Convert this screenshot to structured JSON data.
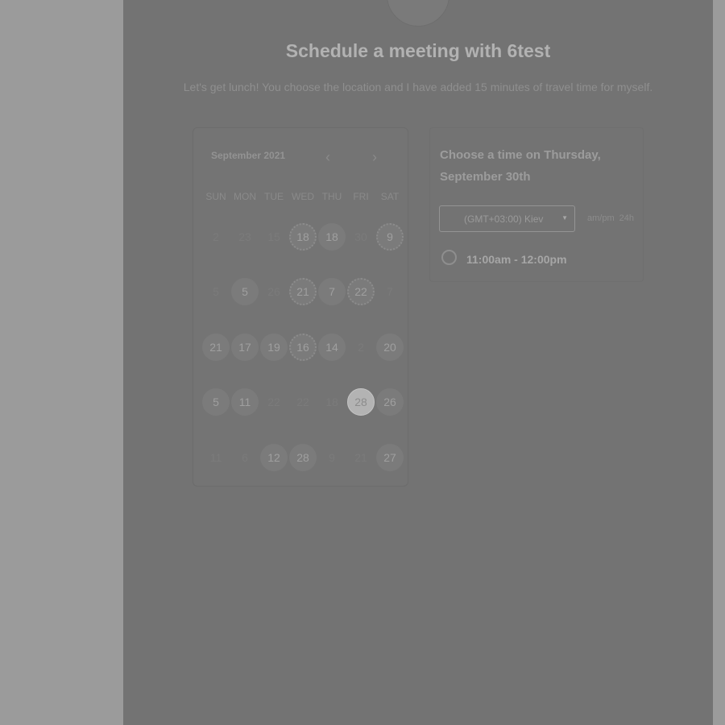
{
  "header": {
    "title": "Schedule a meeting with 6test",
    "description": "Let's get lunch! You choose the location and I have added 15 minutes of travel time for myself."
  },
  "calendar": {
    "month": "September 2021",
    "prev_icon": "‹",
    "next_icon": "›",
    "weekdays": [
      "SUN",
      "MON",
      "TUE",
      "WED",
      "THU",
      "FRI",
      "SAT"
    ],
    "weeks": [
      [
        {
          "d": "2",
          "s": "faint"
        },
        {
          "d": "23",
          "s": "faint"
        },
        {
          "d": "15",
          "s": "faint"
        },
        {
          "d": "18",
          "s": "dotted"
        },
        {
          "d": "18",
          "s": "avail"
        },
        {
          "d": "30",
          "s": "faint"
        },
        {
          "d": "9",
          "s": "dotted"
        }
      ],
      [
        {
          "d": "5",
          "s": "faint"
        },
        {
          "d": "5",
          "s": "avail"
        },
        {
          "d": "26",
          "s": "faint"
        },
        {
          "d": "21",
          "s": "dotted"
        },
        {
          "d": "7",
          "s": "avail"
        },
        {
          "d": "22",
          "s": "dotted"
        },
        {
          "d": "7",
          "s": "faint"
        }
      ],
      [
        {
          "d": "21",
          "s": "avail"
        },
        {
          "d": "17",
          "s": "avail"
        },
        {
          "d": "19",
          "s": "avail"
        },
        {
          "d": "16",
          "s": "dotted"
        },
        {
          "d": "14",
          "s": "avail"
        },
        {
          "d": "2",
          "s": "faint"
        },
        {
          "d": "20",
          "s": "avail"
        }
      ],
      [
        {
          "d": "5",
          "s": "avail"
        },
        {
          "d": "11",
          "s": "avail"
        },
        {
          "d": "22",
          "s": "faint"
        },
        {
          "d": "22",
          "s": "faint"
        },
        {
          "d": "18",
          "s": "faint"
        },
        {
          "d": "28",
          "s": "selected"
        },
        {
          "d": "26",
          "s": "avail"
        }
      ],
      [
        {
          "d": "11",
          "s": "faint"
        },
        {
          "d": "6",
          "s": "faint"
        },
        {
          "d": "12",
          "s": "avail"
        },
        {
          "d": "28",
          "s": "avail"
        },
        {
          "d": "9",
          "s": "faint"
        },
        {
          "d": "21",
          "s": "faint"
        },
        {
          "d": "27",
          "s": "avail"
        }
      ]
    ]
  },
  "time_panel": {
    "heading": "Choose a time on Thursday, September 30th",
    "timezone": "(GMT+03:00) Kiev",
    "format_12": "am/pm",
    "format_24": "24h",
    "slot": "11:00am - 12:00pm"
  }
}
